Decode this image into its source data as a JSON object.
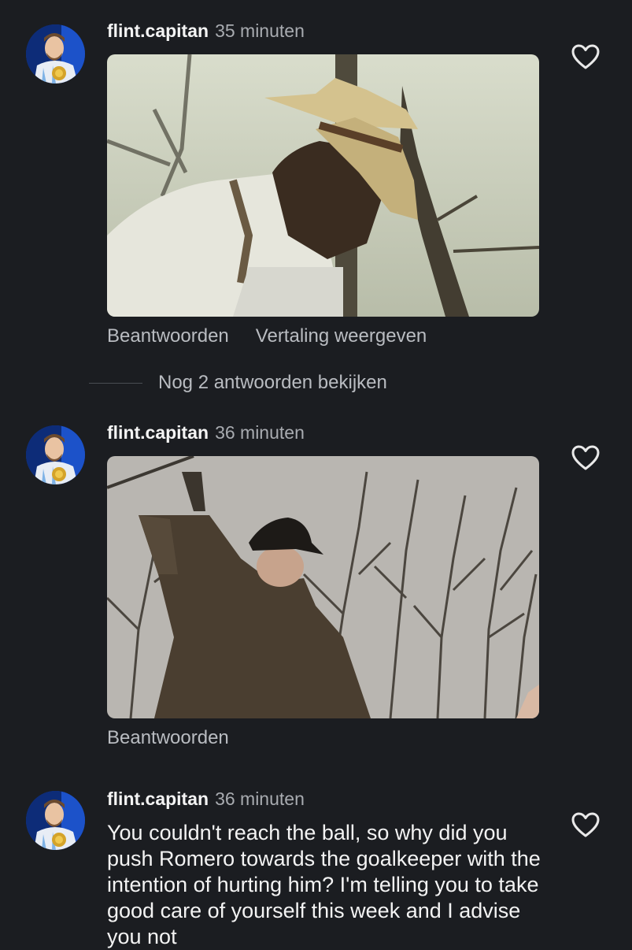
{
  "comments": [
    {
      "username": "flint.capitan",
      "time": "35 minuten",
      "actions": {
        "reply": "Beantwoorden",
        "translate": "Vertaling weergeven"
      },
      "more_replies": "Nog 2 antwoorden bekijken"
    },
    {
      "username": "flint.capitan",
      "time": "36 minuten",
      "actions": {
        "reply": "Beantwoorden"
      }
    },
    {
      "username": "flint.capitan",
      "time": "36 minuten",
      "text": "You couldn't reach the ball, so why did you push Romero towards the goalkeeper with the intention of hurting him? I'm telling you to take good care of yourself this week and I advise you not"
    }
  ],
  "icons": {
    "like": "heart-outline-icon",
    "avatar": "profile-avatar"
  },
  "colors": {
    "background": "#1b1d21",
    "text_primary": "#f4f4f4",
    "text_secondary": "#a8abb0"
  }
}
